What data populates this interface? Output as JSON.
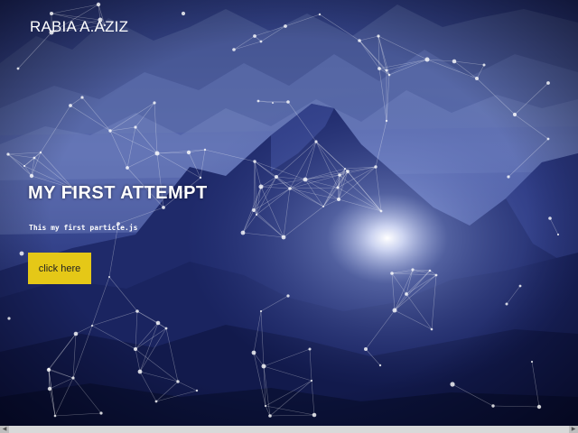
{
  "header": {
    "brand": "RABIA A.AZIZ"
  },
  "hero": {
    "title": "MY FIRST ATTEMPT",
    "subtitle": "This my first particle.js",
    "button_label": "click here"
  },
  "colors": {
    "button_bg": "#e5c817",
    "text": "#ffffff",
    "sky_dark": "#1a225e",
    "mountain": "#2a3a8a"
  },
  "icons": {
    "scroll_left": "triangle-left",
    "scroll_right": "triangle-right"
  }
}
